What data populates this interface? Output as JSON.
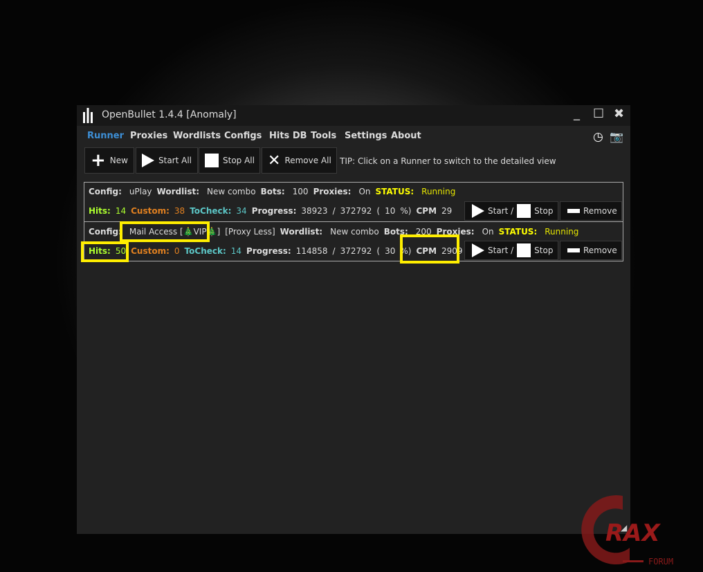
{
  "window": {
    "title": "OpenBullet 1.4.4 [Anomaly]",
    "minimize": "_",
    "maximize": "☐",
    "close": "✖"
  },
  "nav": [
    "Runner",
    "Proxies",
    "Wordlists",
    "Configs",
    "Hits DB",
    "Tools",
    "Settings",
    "About"
  ],
  "toolbar": {
    "new": "New",
    "start_all": "Start All",
    "stop_all": "Stop All",
    "remove_all": "Remove All",
    "tip": "TIP: Click on a Runner to switch to the detailed view"
  },
  "labels": {
    "config": "Config:",
    "wordlist": "Wordlist:",
    "bots": "Bots:",
    "proxies": "Proxies:",
    "status": "STATUS:",
    "hits": "Hits:",
    "custom": "Custom:",
    "tocheck": "ToCheck:",
    "progress": "Progress:",
    "cpm": "CPM",
    "slash": "/",
    "open": "(",
    "close": "%)",
    "start": "Start /",
    "stop": "Stop",
    "remove": "Remove"
  },
  "runners": [
    {
      "config": "uPlay",
      "config_suffix": "",
      "wordlist": "New combo",
      "bots": "100",
      "proxies": "On",
      "status": "Running",
      "hits": "14",
      "custom": "38",
      "tocheck": "34",
      "progress": "38923",
      "total": "372792",
      "percent": "10",
      "cpm": "29"
    },
    {
      "config": "Mail Access [🎄VIP🎄]",
      "config_suffix": "[Proxy Less]",
      "wordlist": "New combo",
      "bots": "200",
      "proxies": "On",
      "status": "Running",
      "hits": "50",
      "custom": "0",
      "tocheck": "14",
      "progress": "114858",
      "total": "372792",
      "percent": "30",
      "cpm": "2909"
    }
  ],
  "watermark": {
    "text": "CRAX FORUM"
  },
  "colors": {
    "accent": "#3d8fd6",
    "hits": "#adff2f",
    "custom": "#e08020",
    "tocheck": "#5cc6c6",
    "status": "#ffff00",
    "highlight": "#ffee00"
  }
}
